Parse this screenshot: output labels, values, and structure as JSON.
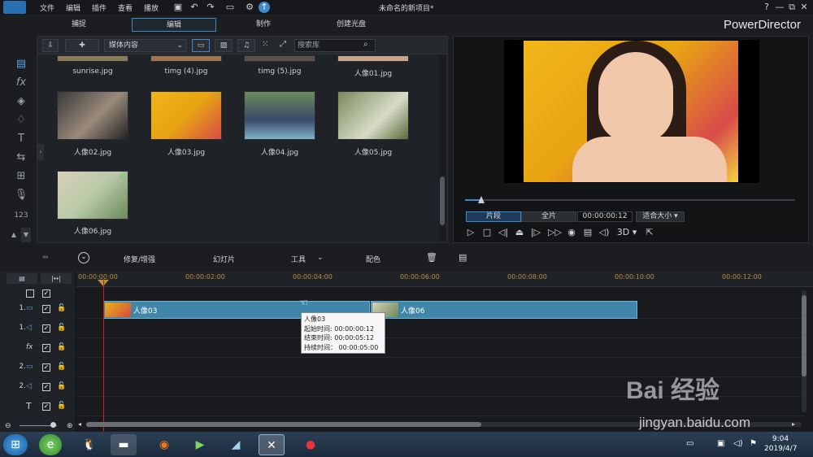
{
  "menu": [
    "文件",
    "编辑",
    "插件",
    "查看",
    "播放"
  ],
  "window_title": "未命名的新项目*",
  "window_buttons": [
    "?",
    "—",
    "⧉",
    "✕"
  ],
  "modes": {
    "capture": "捕捉",
    "edit": "编辑",
    "produce": "制作",
    "disc": "创建光盘"
  },
  "brand": "PowerDirector",
  "library": {
    "media_select": "媒体内容",
    "search_placeholder": "搜索库",
    "items": [
      {
        "name": "sunrise.jpg",
        "checked": false
      },
      {
        "name": "timg (4).jpg",
        "checked": false
      },
      {
        "name": "timg (5).jpg",
        "checked": false
      },
      {
        "name": "人像01.jpg",
        "checked": false
      },
      {
        "name": "人像02.jpg",
        "checked": false
      },
      {
        "name": "人像03.jpg",
        "checked": true
      },
      {
        "name": "人像04.jpg",
        "checked": false
      },
      {
        "name": "人像05.jpg",
        "checked": false
      },
      {
        "name": "人像06.jpg",
        "checked": true
      }
    ]
  },
  "preview": {
    "clip_label": "片段",
    "full_label": "全片",
    "timecode": "00:00:00:12",
    "fit_label": "适合大小",
    "mode_3d": "3D"
  },
  "timeline_toolbar": {
    "fix": "修复/增强",
    "slideshow": "幻灯片",
    "tools": "工具",
    "color": "配色"
  },
  "ruler": [
    "00:00:00:00",
    "00:00:02:00",
    "00:00:04:00",
    "00:00:06:00",
    "00:00:08:00",
    "00:00:10:00",
    "00:00:12:00"
  ],
  "tracks": [
    {
      "num": "",
      "icon": ""
    },
    {
      "num": "1.",
      "icon": "▭"
    },
    {
      "num": "1.",
      "icon": "◁"
    },
    {
      "num": "",
      "icon": "fx"
    },
    {
      "num": "2.",
      "icon": "▭"
    },
    {
      "num": "2.",
      "icon": "◁"
    },
    {
      "num": "",
      "icon": "T"
    }
  ],
  "clips": [
    {
      "name": "人像03"
    },
    {
      "name": "人像06"
    }
  ],
  "tooltip": {
    "title": "人像03",
    "start": "起始时间: 00:00:00:12",
    "end": "结束时间: 00:00:05:12",
    "duration": "持续时间： 00:00:05:00"
  },
  "clock": {
    "time": "9:04",
    "date": "2019/4/7"
  },
  "watermark": {
    "brand": "Bai 经验",
    "url": "jingyan.baidu.com"
  },
  "colors": {
    "accent": "#3f88c9",
    "playhead": "#c9232a",
    "clip": "#3f86a8"
  }
}
